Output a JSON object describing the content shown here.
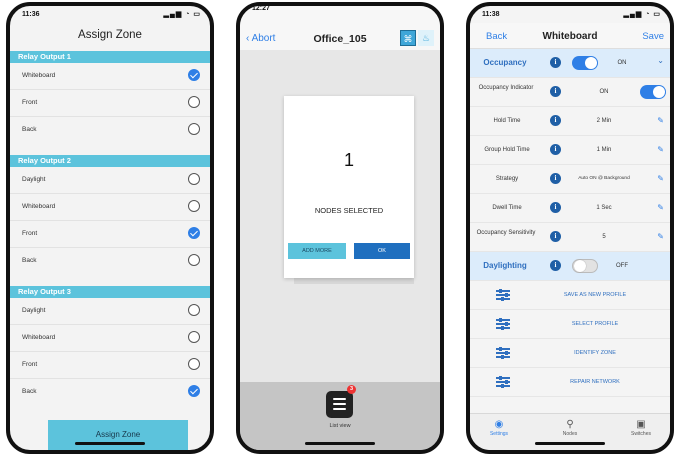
{
  "screen1": {
    "status_time": "11:36",
    "title": "Assign Zone",
    "sections": [
      {
        "header": "Relay Output 1",
        "items": [
          {
            "label": "Whiteboard",
            "selected": true
          },
          {
            "label": "Front",
            "selected": false
          },
          {
            "label": "Back",
            "selected": false
          }
        ]
      },
      {
        "header": "Relay Output 2",
        "items": [
          {
            "label": "Daylight",
            "selected": false
          },
          {
            "label": "Whiteboard",
            "selected": false
          },
          {
            "label": "Front",
            "selected": true
          },
          {
            "label": "Back",
            "selected": false
          }
        ]
      },
      {
        "header": "Relay Output 3",
        "items": [
          {
            "label": "Daylight",
            "selected": false
          },
          {
            "label": "Whiteboard",
            "selected": false
          },
          {
            "label": "Front",
            "selected": false
          },
          {
            "label": "Back",
            "selected": true
          }
        ]
      }
    ],
    "assign_button": "Assign Zone",
    "accent_color": "#5cc3dc"
  },
  "screen2": {
    "status_time": "12:27",
    "abort_label": "Abort",
    "title": "Office_105",
    "selected_count": "1",
    "selected_label": "NODES SELECTED",
    "add_more_label": "ADD MORE",
    "ok_label": "OK",
    "list_badge": "3",
    "list_label": "List view"
  },
  "screen3": {
    "status_time": "11:38",
    "back_label": "Back",
    "title": "Whiteboard",
    "save_label": "Save",
    "occupancy": {
      "label": "Occupancy",
      "value": "ON",
      "enabled": true
    },
    "settings": [
      {
        "label": "Occupancy Indicator",
        "value": "ON",
        "control": "toggle-on"
      },
      {
        "label": "Hold Time",
        "value": "2 Min",
        "control": "edit"
      },
      {
        "label": "Group Hold Time",
        "value": "1 Min",
        "control": "edit"
      },
      {
        "label": "Strategy",
        "value": "Auto ON @ Background",
        "control": "edit"
      },
      {
        "label": "Dwell Time",
        "value": "1 Sec",
        "control": "edit"
      },
      {
        "label": "Occupancy Sensitivity",
        "value": "5",
        "control": "edit"
      }
    ],
    "daylighting": {
      "label": "Daylighting",
      "value": "OFF",
      "enabled": false
    },
    "actions": [
      "SAVE AS NEW PROFILE",
      "SELECT PROFILE",
      "IDENTIFY ZONE",
      "REPAIR NETWORK"
    ],
    "tabs": [
      {
        "label": "Settings",
        "icon": "settings-icon",
        "active": true
      },
      {
        "label": "Nodes",
        "icon": "bulb-icon",
        "active": false
      },
      {
        "label": "Switches",
        "icon": "switch-icon",
        "active": false
      }
    ],
    "primary_color": "#2f7fe6"
  }
}
